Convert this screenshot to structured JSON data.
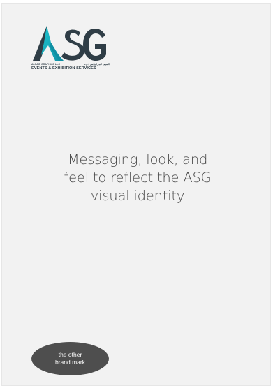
{
  "logo": {
    "wordmark": "ASG",
    "company_line": "ALSAIF GRAPHICS LLC",
    "arabic_line": "السيف للجرافيكس ذ.م.م",
    "tagline": "EVENTS & EXHIBITION SERVICES",
    "colors": {
      "letters": "#2f3d46",
      "accent_teal": "#17b6c4"
    }
  },
  "headline": {
    "line1": "Messaging, look, and",
    "line2": "feel to reflect the ASG",
    "line3": "visual identity"
  },
  "brand_mark": {
    "line1": "the other",
    "line2": "brand mark",
    "color": "#4e4e4e"
  }
}
